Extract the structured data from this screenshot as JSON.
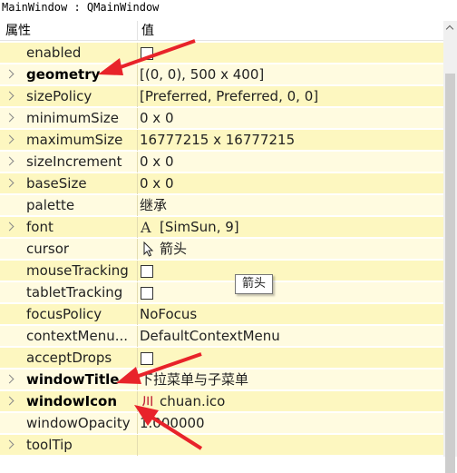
{
  "window": {
    "title": "MainWindow : QMainWindow"
  },
  "header": {
    "property": "属性",
    "value": "值"
  },
  "rows": [
    {
      "name": "enabled",
      "bold": false,
      "expandable": false,
      "type": "check",
      "value": ""
    },
    {
      "name": "geometry",
      "bold": true,
      "expandable": true,
      "type": "text",
      "value": "[(0, 0), 500 x 400]"
    },
    {
      "name": "sizePolicy",
      "bold": false,
      "expandable": true,
      "type": "text",
      "value": "[Preferred, Preferred, 0, 0]"
    },
    {
      "name": "minimumSize",
      "bold": false,
      "expandable": true,
      "type": "text",
      "value": "0 x 0"
    },
    {
      "name": "maximumSize",
      "bold": false,
      "expandable": true,
      "type": "text",
      "value": "16777215 x 16777215"
    },
    {
      "name": "sizeIncrement",
      "bold": false,
      "expandable": true,
      "type": "text",
      "value": "0 x 0"
    },
    {
      "name": "baseSize",
      "bold": false,
      "expandable": true,
      "type": "text",
      "value": "0 x 0"
    },
    {
      "name": "palette",
      "bold": false,
      "expandable": false,
      "type": "text",
      "value": "继承"
    },
    {
      "name": "font",
      "bold": false,
      "expandable": true,
      "type": "font",
      "value": "[SimSun, 9]",
      "icon_text": "A"
    },
    {
      "name": "cursor",
      "bold": false,
      "expandable": false,
      "type": "cursor",
      "value": "箭头"
    },
    {
      "name": "mouseTracking",
      "bold": false,
      "expandable": false,
      "type": "check",
      "value": ""
    },
    {
      "name": "tabletTracking",
      "bold": false,
      "expandable": false,
      "type": "check",
      "value": ""
    },
    {
      "name": "focusPolicy",
      "bold": false,
      "expandable": false,
      "type": "text",
      "value": "NoFocus"
    },
    {
      "name": "contextMenu...",
      "bold": false,
      "expandable": false,
      "type": "text",
      "value": "DefaultContextMenu"
    },
    {
      "name": "acceptDrops",
      "bold": false,
      "expandable": false,
      "type": "check",
      "value": ""
    },
    {
      "name": "windowTitle",
      "bold": true,
      "expandable": true,
      "type": "text",
      "value": "下拉菜单与子菜单"
    },
    {
      "name": "windowIcon",
      "bold": true,
      "expandable": true,
      "type": "icon",
      "value": "chuan.ico",
      "icon_text": "川"
    },
    {
      "name": "windowOpacity",
      "bold": false,
      "expandable": false,
      "type": "text",
      "value": "1.000000"
    },
    {
      "name": "toolTip",
      "bold": false,
      "expandable": true,
      "type": "text",
      "value": ""
    }
  ],
  "tooltip": {
    "text": "箭头"
  },
  "colors": {
    "row_alt_dark": "#fdf7c0",
    "row_alt_light": "#fffbe0",
    "annotation_arrow": "#e8232a"
  },
  "icons": {
    "expand": "chevron-right-icon",
    "cursor": "arrow-cursor-icon",
    "window_icon": "chuan-icon"
  }
}
